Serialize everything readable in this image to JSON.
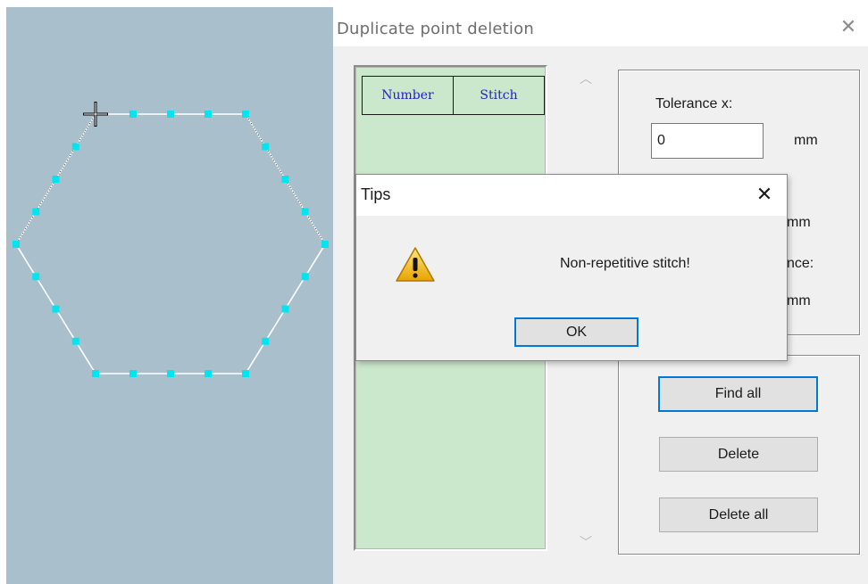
{
  "canvas": {
    "background_color": "#a9c0cc",
    "shape": "hexagon",
    "point_color": "#00e5ef",
    "line_color": "#ffffff",
    "cursor_icon": "crosshair-icon"
  },
  "dialog": {
    "title": "Duplicate point deletion",
    "close_icon": "close-icon",
    "list": {
      "columns": [
        "Number",
        "Stitch"
      ],
      "rows": []
    },
    "scroll_up_icon": "chevron-up-icon",
    "scroll_down_icon": "chevron-down-icon",
    "tolerance_x_label": "Tolerance x:",
    "tolerance_x_value": "0",
    "unit_mm": "mm",
    "unit_mm_2": "mm",
    "unit_mm_3": "mm",
    "partial_label_nce": "nce:",
    "buttons": {
      "find_all": "Find all",
      "delete": "Delete",
      "delete_all": "Delete all"
    }
  },
  "tips": {
    "title": "Tips",
    "close_icon": "close-icon",
    "icon": "warning-icon",
    "message": "Non-repetitive stitch!",
    "ok_label": "OK"
  }
}
